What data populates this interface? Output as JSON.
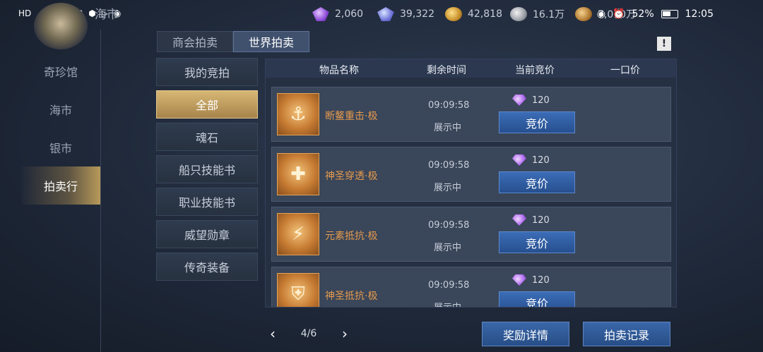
{
  "status_bar": {
    "left_indicators": [
      "HD",
      "4G",
      "wifi",
      "heart",
      "shield",
      "video",
      "shield",
      "wechat"
    ],
    "currencies": [
      {
        "icon": "purple-gem-icon",
        "value": "2,060"
      },
      {
        "icon": "violet-gem-icon",
        "value": "39,322"
      },
      {
        "icon": "gold-coin-icon",
        "value": "42,818"
      },
      {
        "icon": "silver-coin-icon",
        "value": "16.1万"
      },
      {
        "icon": "bronze-coin-icon",
        "value": "7,010万"
      }
    ],
    "battery": "52%",
    "time": "12:05"
  },
  "header": {
    "title": "海市"
  },
  "left_nav": {
    "items": [
      {
        "label": "奇珍馆",
        "active": false
      },
      {
        "label": "海市",
        "active": false
      },
      {
        "label": "银市",
        "active": false
      },
      {
        "label": "拍卖行",
        "active": true
      }
    ]
  },
  "top_tabs": [
    {
      "label": "商会拍卖",
      "active": false
    },
    {
      "label": "世界拍卖",
      "active": true
    }
  ],
  "info_button": "!",
  "categories": [
    {
      "label": "我的竞拍",
      "active": false
    },
    {
      "label": "全部",
      "active": true
    },
    {
      "label": "魂石",
      "active": false
    },
    {
      "label": "船只技能书",
      "active": false
    },
    {
      "label": "职业技能书",
      "active": false
    },
    {
      "label": "威望勋章",
      "active": false
    },
    {
      "label": "传奇装备",
      "active": false
    }
  ],
  "table": {
    "headers": [
      "物品名称",
      "剩余时间",
      "当前竞价",
      "一口价"
    ],
    "rows": [
      {
        "name": "断鳌重击·极",
        "time": "09:09:58",
        "state": "展示中",
        "price": "120",
        "button": "竞价",
        "icon": "whale-strike-icon"
      },
      {
        "name": "神圣穿透·极",
        "time": "09:09:58",
        "state": "展示中",
        "price": "120",
        "button": "竞价",
        "icon": "holy-pierce-icon"
      },
      {
        "name": "元素抵抗·极",
        "time": "09:09:58",
        "state": "展示中",
        "price": "120",
        "button": "竞价",
        "icon": "element-resist-icon"
      },
      {
        "name": "神圣抵抗·极",
        "time": "09:09:58",
        "state": "展示中",
        "price": "120",
        "button": "竞价",
        "icon": "holy-resist-icon"
      }
    ]
  },
  "pager": {
    "text": "4/6"
  },
  "bottom_buttons": {
    "reward": "奖励详情",
    "record": "拍卖记录"
  }
}
